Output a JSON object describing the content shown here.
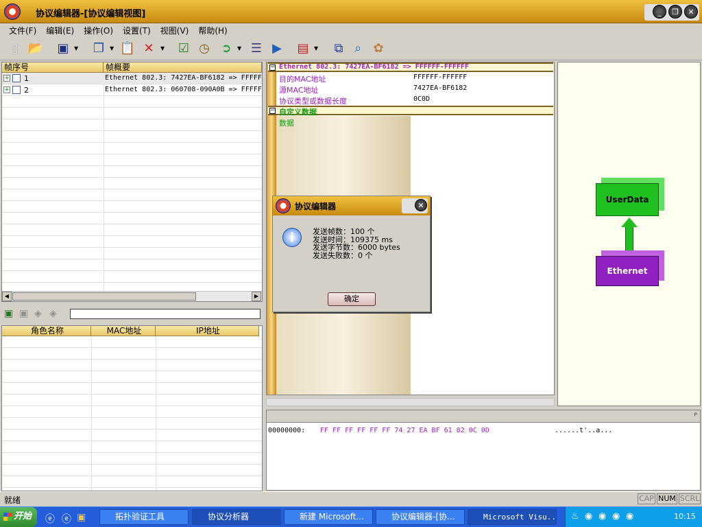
{
  "window": {
    "title": "协议编辑器-[协议编辑视图]"
  },
  "menu": [
    "文件(F)",
    "编辑(E)",
    "操作(O)",
    "设置(T)",
    "视图(V)",
    "帮助(H)"
  ],
  "toolbar_icons": [
    "new-file-icon",
    "open-folder-icon",
    "save-icon",
    "copy-icon",
    "paste-icon",
    "delete-icon",
    "check-icon",
    "clock-icon",
    "export-icon",
    "list-icon",
    "play-icon",
    "card-icon",
    "network-icon",
    "search-icon",
    "palette-icon"
  ],
  "frame_table": {
    "headers": [
      "帧序号",
      "帧概要"
    ],
    "rows": [
      {
        "num": "1",
        "summary": "Ethernet 802.3: 7427EA-BF6182 => FFFFFF"
      },
      {
        "num": "2",
        "summary": "Ethernet 802.3: 060708-090A0B => FFFFFF"
      }
    ]
  },
  "role_table": {
    "headers": [
      "角色名称",
      "MAC地址",
      "IP地址"
    ]
  },
  "detail": {
    "section1": "Ethernet 802.3: 7427EA-BF6182 => FFFFFF-FFFFFF",
    "fields": [
      {
        "name": "目的MAC地址",
        "value": "FFFFFF-FFFFFF"
      },
      {
        "name": "源MAC地址",
        "value": "7427EA-BF6182"
      },
      {
        "name": "协议类型或数据长度",
        "value": "0C0D"
      }
    ],
    "section2": "自定义数据",
    "data_label": "数据"
  },
  "graph": {
    "top": "UserData",
    "bottom": "Ethernet"
  },
  "hex": {
    "offset": "00000000:",
    "bytes": "FF FF FF FF FF FF 74 27 EA BF 61 82 0C 0D",
    "ascii": "......t'..a..."
  },
  "dialog": {
    "title": "协议编辑器",
    "lines": [
      "发送帧数：100 个",
      "发送时间：109375 ms",
      "发送字节数：6000 bytes",
      "发送失败数：0 个"
    ],
    "ok": "确定"
  },
  "status": {
    "text": "就绪",
    "cap": "CAP",
    "num": "NUM",
    "scrl": "SCRL"
  },
  "taskbar": {
    "start": "开始",
    "tasks": [
      "拓扑验证工具",
      "协议分析器",
      "新建 Microsoft...",
      "协议编辑器-[协...",
      "Microsoft Visu..."
    ],
    "clock": "10:15"
  }
}
